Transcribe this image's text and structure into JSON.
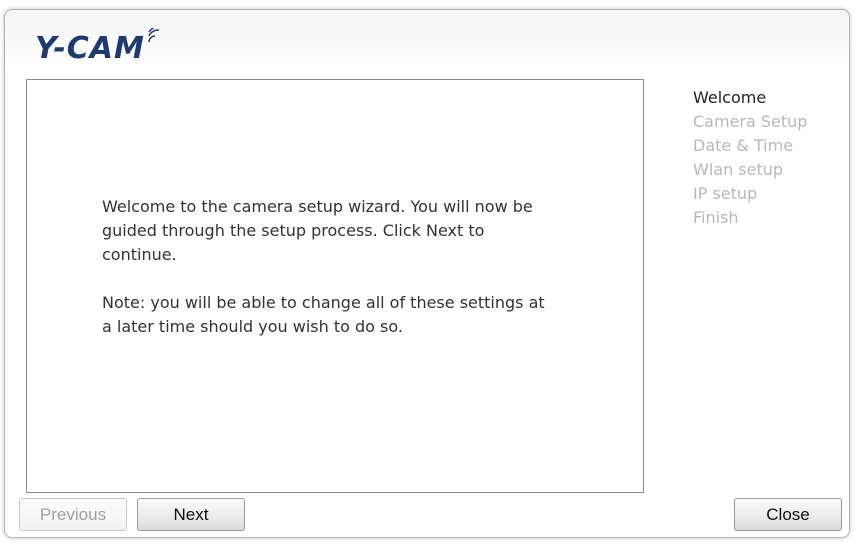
{
  "brand": {
    "logo_text": "Y-CAM",
    "logo_color": "#1f3a6e"
  },
  "content": {
    "paragraph1": "Welcome to the camera setup wizard. You will now be guided through the setup process. Click Next to continue.",
    "paragraph2": "Note: you will be able to change all of these settings at a later time should you wish to do so."
  },
  "steps": {
    "active_color": "#222222",
    "inactive_color": "#b8b8b8",
    "items": [
      {
        "label": "Welcome",
        "active": true
      },
      {
        "label": "Camera Setup",
        "active": false
      },
      {
        "label": "Date & Time",
        "active": false
      },
      {
        "label": "Wlan setup",
        "active": false
      },
      {
        "label": "IP setup",
        "active": false
      },
      {
        "label": "Finish",
        "active": false
      }
    ]
  },
  "buttons": {
    "previous_label": "Previous",
    "previous_enabled": false,
    "next_label": "Next",
    "close_label": "Close"
  }
}
